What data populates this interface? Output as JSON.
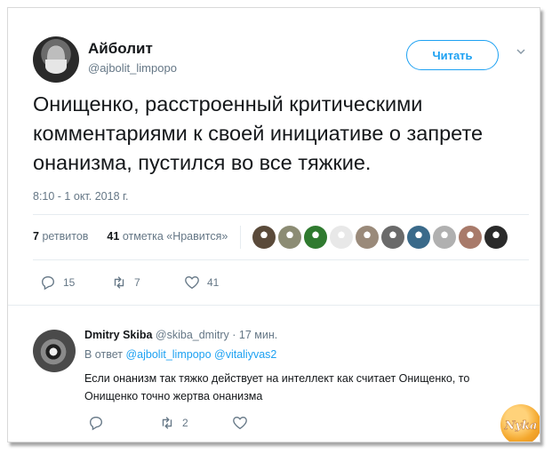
{
  "tweet": {
    "author_name": "Айболит",
    "author_handle": "@ajbolit_limpopo",
    "follow_label": "Читать",
    "text": "Онищенко, расстроенный критическими комментариями к своей инициативе о запрете онанизма, пустился во все тяжкие.",
    "timestamp": "8:10 - 1 окт. 2018 г.",
    "retweets_count": "7",
    "retweets_label": "ретвитов",
    "likes_count": "41",
    "likes_label": "отметка «Нравится»",
    "actions": {
      "replies": "15",
      "retweets": "7",
      "likes": "41"
    },
    "liker_avatar_colors": [
      "#5a4a3a",
      "#8c8c74",
      "#2f7a2f",
      "#e8e8e8",
      "#9a8a7a",
      "#6a6a6a",
      "#3a6a8a",
      "#b0b0b0",
      "#a87a6a",
      "#2a2a2a"
    ]
  },
  "reply": {
    "author_name": "Dmitry Skiba",
    "author_handle": "@skiba_dmitry",
    "time": "· 17 мин.",
    "reply_to_prefix": "В ответ",
    "reply_to_users": "@ajbolit_limpopo @vitaliyvas2",
    "text": "Если онанизм так тяжко действует на интеллект как считает Онищенко, то Онищенко точно жертва онанизма",
    "actions": {
      "retweets": "2"
    }
  },
  "watermark_text": "Nyka",
  "colors": {
    "accent": "#1da1f2",
    "muted": "#657786",
    "text": "#14171a",
    "border": "#e6ecf0"
  }
}
